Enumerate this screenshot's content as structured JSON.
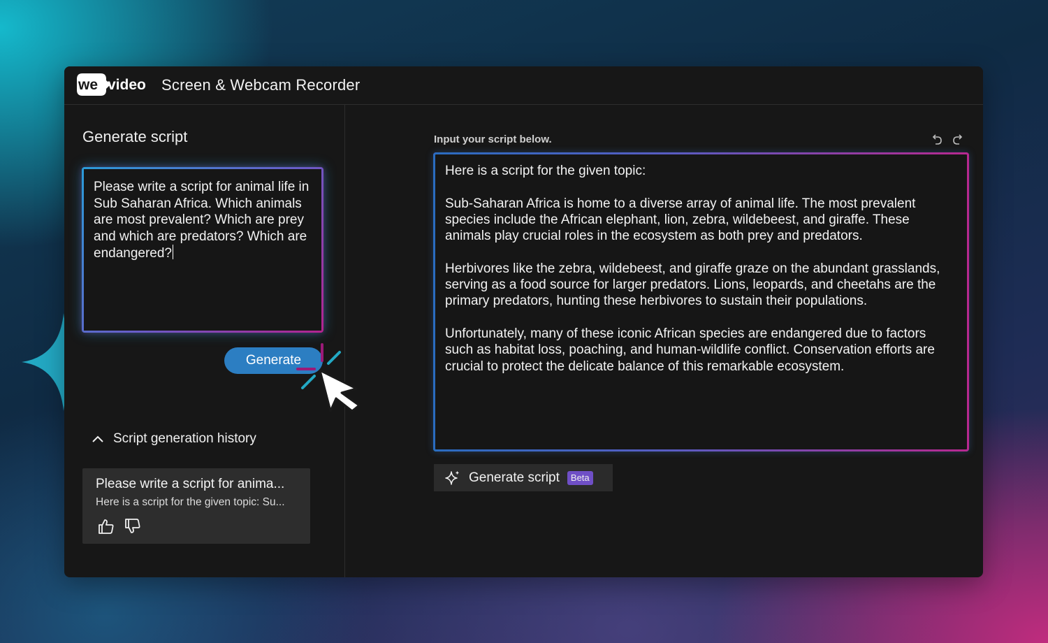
{
  "window": {
    "logo_text": "wevideo",
    "title": "Screen & Webcam Recorder"
  },
  "left_panel": {
    "title": "Generate script",
    "prompt_text": "Please write a script for animal life in Sub Saharan Africa. Which animals are most prevalent? Which are prey and which are predators? Which are endangered?",
    "generate_button": "Generate",
    "history": {
      "toggle_label": "Script generation history",
      "toggle_icon": "chevron-up-icon",
      "items": [
        {
          "title": "Please write a script for anima...",
          "preview": "Here is a script for the given topic: Su...",
          "like_icon": "thumbs-up-icon",
          "dislike_icon": "thumbs-down-icon"
        }
      ]
    }
  },
  "right_panel": {
    "label": "Input your script below.",
    "undo_icon": "undo-icon",
    "redo_icon": "redo-icon",
    "script_paragraphs": [
      "Here is a script for the given topic:",
      "Sub-Saharan Africa is home to a diverse array of animal life. The most prevalent species include the African elephant, lion, zebra, wildebeest, and giraffe. These animals play crucial roles in the ecosystem as both prey and predators.",
      "Herbivores like the zebra, wildebeest, and giraffe graze on the abundant grasslands, serving as a food source for larger predators. Lions, leopards, and cheetahs are the primary predators, hunting these herbivores to sustain their populations.",
      "Unfortunately, many of these iconic African species are endangered due to factors such as habitat loss, poaching, and human-wildlife conflict. Conservation efforts are crucial to protect the delicate balance of this remarkable ecosystem."
    ],
    "generate_script_button": "Generate script",
    "beta_badge": "Beta"
  },
  "colors": {
    "accent_blue": "#2c7ec2",
    "accent_magenta": "#9b1a78",
    "accent_teal": "#23a9c4",
    "beta_purple": "#6f4fc6",
    "panel_bg": "#171717"
  }
}
